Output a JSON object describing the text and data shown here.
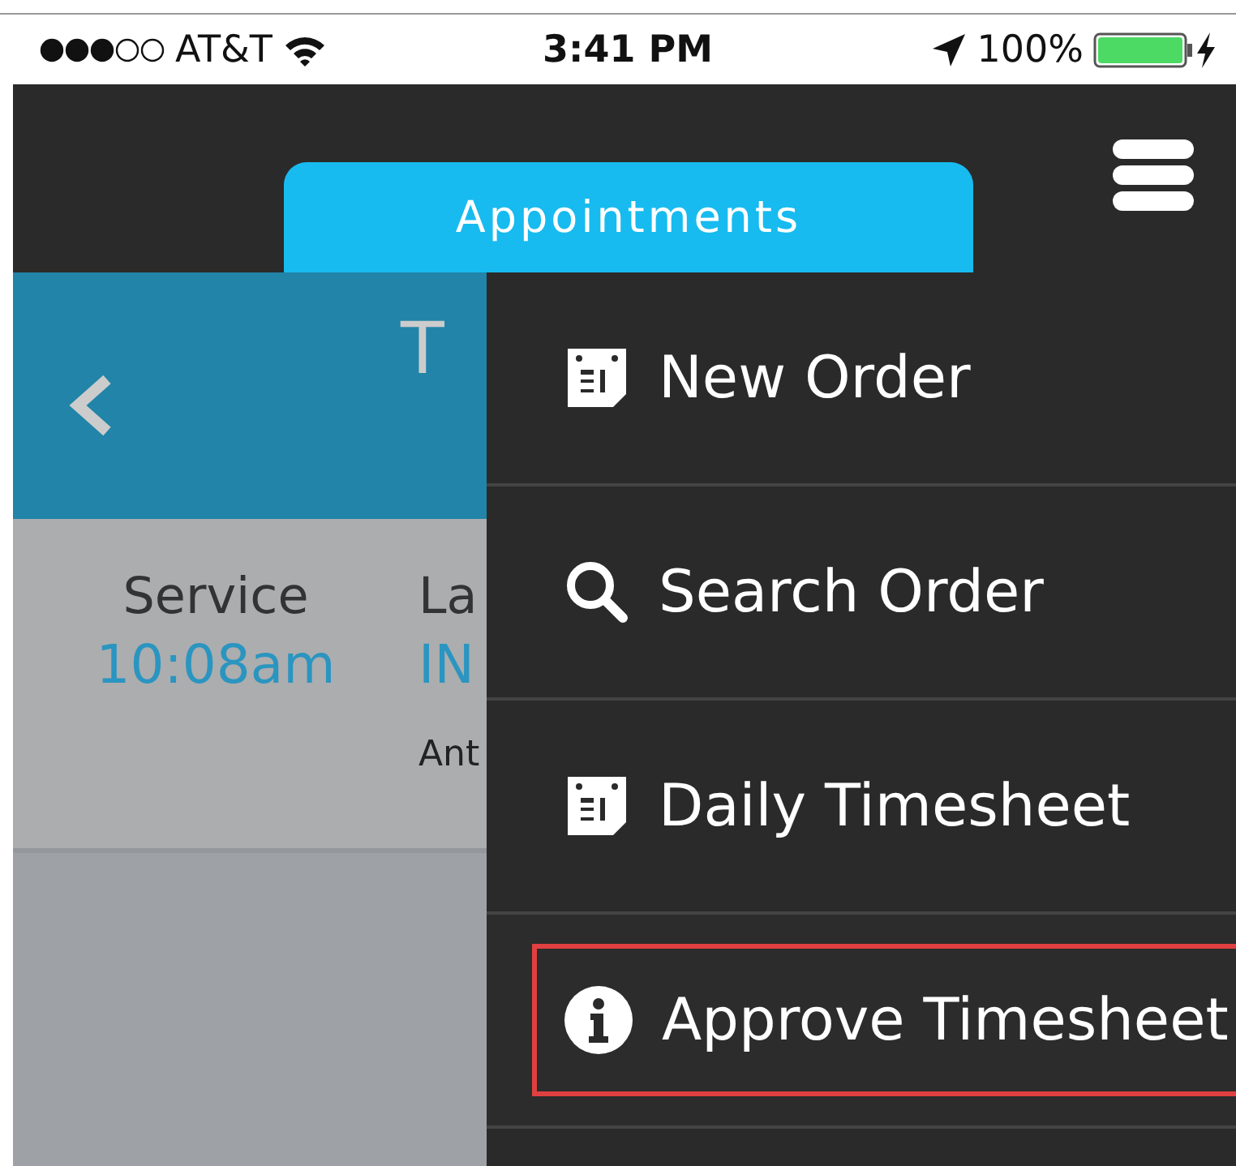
{
  "status_bar": {
    "carrier": "AT&T",
    "time": "3:41 PM",
    "battery": "100%"
  },
  "header": {
    "tab": "Appointments"
  },
  "screen": {
    "title": "T",
    "columns": [
      {
        "label": "Service",
        "value": "10:08am"
      },
      {
        "label": "La",
        "value": "IN",
        "note": "Ant"
      }
    ]
  },
  "menu": {
    "items": [
      {
        "label": "New Order",
        "kind": "calendar",
        "selected": false
      },
      {
        "label": "Search Order",
        "kind": "search",
        "selected": false
      },
      {
        "label": "Daily Timesheet",
        "kind": "calendar",
        "selected": false
      },
      {
        "label": "Approve Timesheet",
        "kind": "info",
        "selected": true
      }
    ]
  }
}
